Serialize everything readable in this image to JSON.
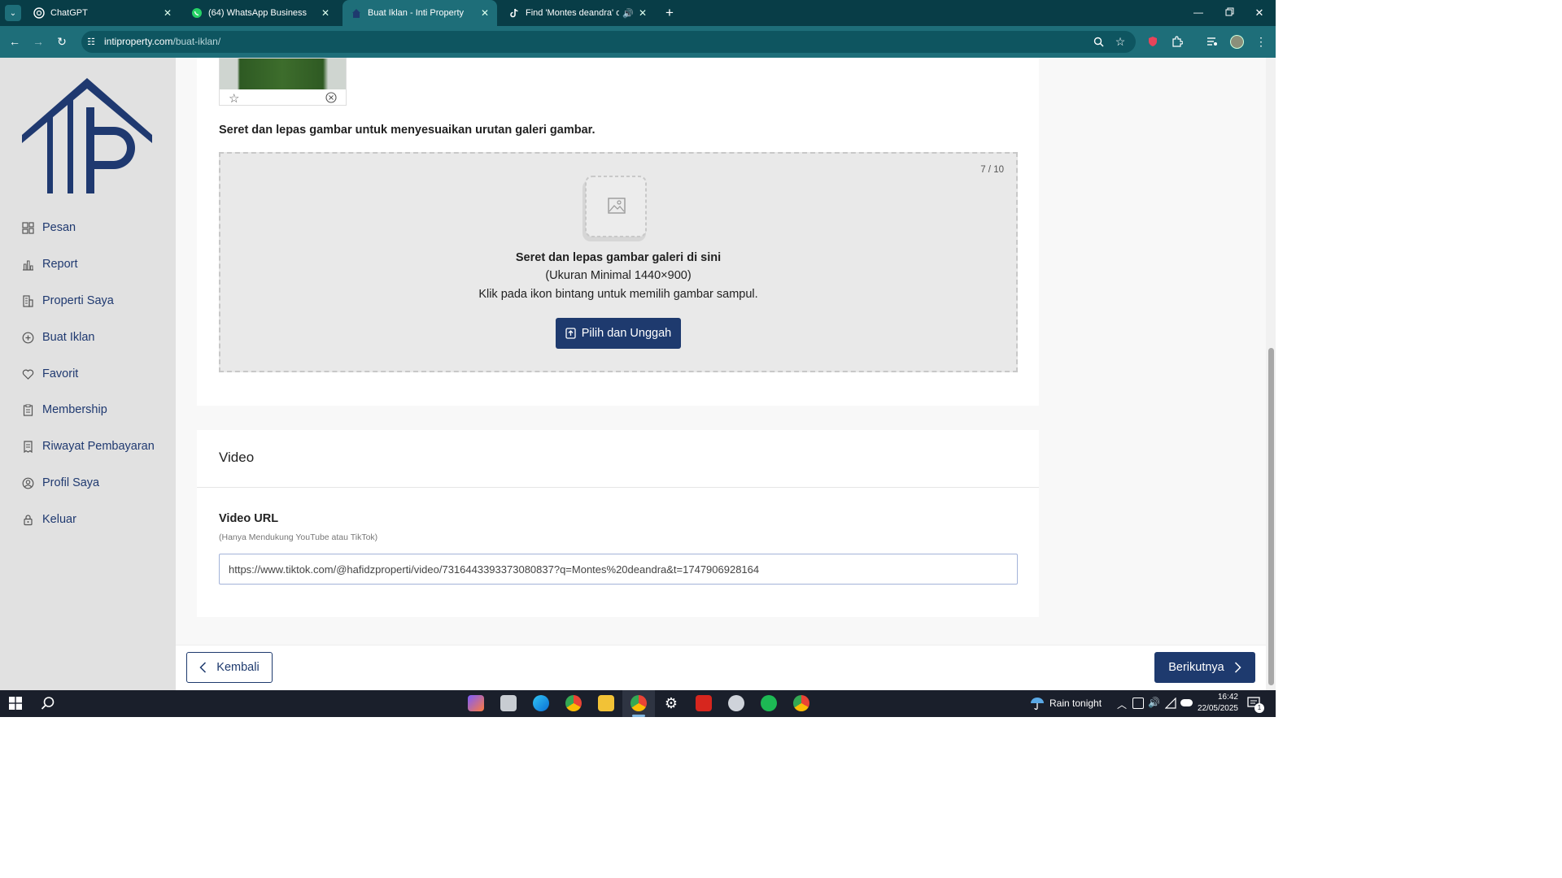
{
  "browser": {
    "tabs": [
      {
        "title": "ChatGPT",
        "icon": "chatgpt-icon"
      },
      {
        "title": "(64) WhatsApp Business",
        "icon": "whatsapp-icon"
      },
      {
        "title": "Buat Iklan - Inti Property",
        "icon": "site-icon"
      },
      {
        "title": "Find 'Montes deandra' on T",
        "icon": "tiktok-icon"
      }
    ],
    "url_host": "intiproperty.com",
    "url_path": "/buat-iklan/"
  },
  "sidebar": {
    "logo_text": "IIP",
    "items": [
      {
        "label": "Pesan",
        "icon": "message-icon"
      },
      {
        "label": "Report",
        "icon": "chart-icon"
      },
      {
        "label": "Properti Saya",
        "icon": "building-icon"
      },
      {
        "label": "Buat Iklan",
        "icon": "plus-circle-icon"
      },
      {
        "label": "Favorit",
        "icon": "heart-icon"
      },
      {
        "label": "Membership",
        "icon": "clipboard-icon"
      },
      {
        "label": "Riwayat Pembayaran",
        "icon": "receipt-icon"
      },
      {
        "label": "Profil Saya",
        "icon": "user-circle-icon"
      },
      {
        "label": "Keluar",
        "icon": "lock-icon"
      }
    ]
  },
  "gallery": {
    "instruction": "Seret dan lepas gambar untuk menyesuaikan urutan galeri gambar.",
    "counter": "7 / 10",
    "drop_title": "Seret dan lepas gambar galeri di sini",
    "drop_size": "(Ukuran Minimal 1440×900)",
    "drop_hint": "Klik pada ikon bintang untuk memilih gambar sampul.",
    "upload_label": "Pilih dan Unggah"
  },
  "video": {
    "section_title": "Video",
    "field_label": "Video URL",
    "field_hint": "(Hanya Mendukung YouTube atau TikTok)",
    "field_value": "https://www.tiktok.com/@hafidzproperti/video/7316443393373080837?q=Montes%20deandra&t=1747906928164"
  },
  "footer": {
    "back_label": "Kembali",
    "next_label": "Berikutnya"
  },
  "taskbar": {
    "weather": "Rain tonight",
    "time": "16:42",
    "date": "22/05/2025",
    "notification_count": "1"
  }
}
